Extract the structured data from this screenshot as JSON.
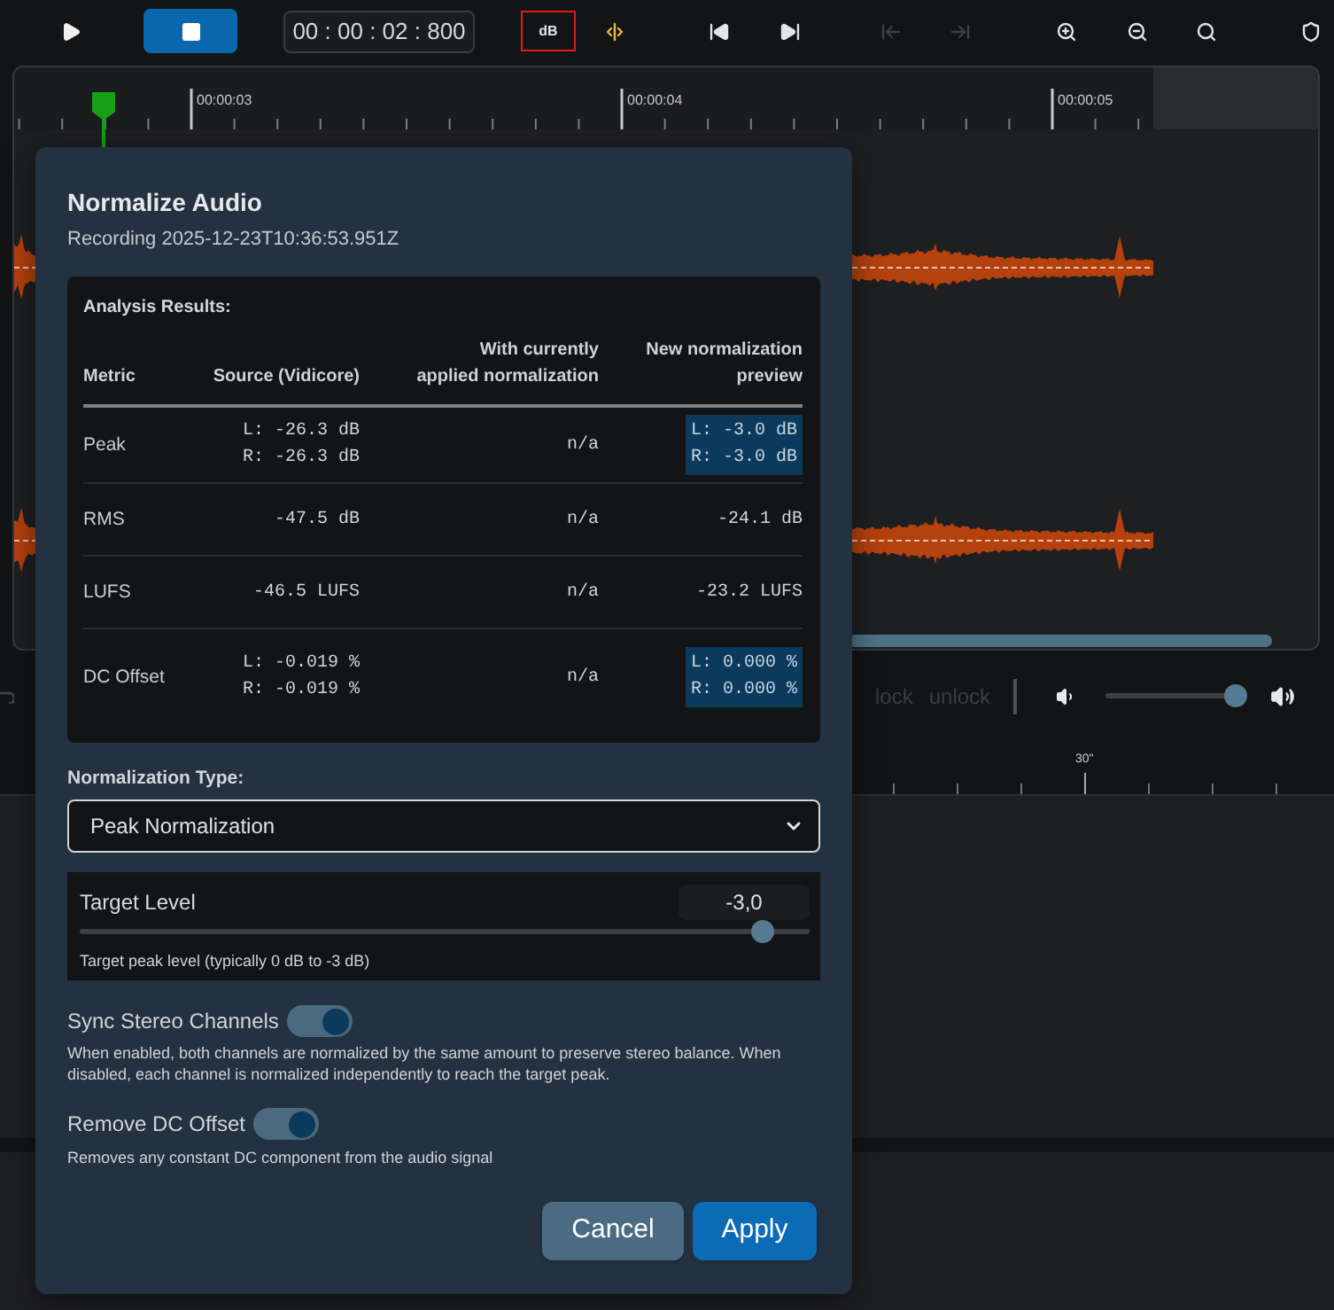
{
  "toolbar": {
    "transport": [
      {
        "kind": "play",
        "active": false
      },
      {
        "kind": "stop",
        "active": true
      }
    ],
    "time_display": "00 : 00 : 02 : 800",
    "tools": [
      {
        "kind": "text",
        "label": "dB",
        "highlighted": true,
        "disabled": false
      },
      {
        "kind": "split",
        "highlighted": false,
        "disabled": false
      },
      {
        "kind": "skip-start",
        "highlighted": false,
        "disabled": false
      },
      {
        "kind": "skip-end",
        "highlighted": false,
        "disabled": false
      },
      {
        "kind": "step-back",
        "highlighted": false,
        "disabled": true
      },
      {
        "kind": "step-forward",
        "highlighted": false,
        "disabled": true
      },
      {
        "kind": "zoom-in",
        "highlighted": false,
        "disabled": false
      },
      {
        "kind": "zoom-out",
        "highlighted": false,
        "disabled": false
      },
      {
        "kind": "zoom-fit",
        "highlighted": false,
        "disabled": false
      },
      {
        "kind": "marker",
        "highlighted": false,
        "disabled": false
      }
    ]
  },
  "timeline": {
    "ruler_labels": [
      "00:00:03",
      "00:00:04",
      "00:00:05"
    ]
  },
  "track_controls": {
    "buttons": [
      {
        "label": "lock",
        "disabled": true
      },
      {
        "label": "unlock",
        "disabled": true
      }
    ],
    "volume": {
      "level": 1
    }
  },
  "bottom_ruler": {
    "labels": [
      "30\""
    ]
  },
  "dialog": {
    "title": "Normalize Audio",
    "subtitle": "Recording 2025-12-23T10:36:53.951Z",
    "analysis": {
      "heading": "Analysis Results:",
      "columns": [
        "Metric",
        "Source (Vidicore)",
        "With currently applied normalization",
        "New normalization preview"
      ],
      "rows": [
        {
          "metric": "Peak",
          "source": [
            "L: -26.3 dB",
            "R: -26.3 dB"
          ],
          "current": [
            "n/a"
          ],
          "preview": [
            "L: -3.0 dB",
            "R: -3.0 dB"
          ],
          "preview_highlighted": true
        },
        {
          "metric": "RMS",
          "source": [
            "-47.5 dB"
          ],
          "current": [
            "n/a"
          ],
          "preview": [
            "-24.1 dB"
          ],
          "preview_highlighted": false
        },
        {
          "metric": "LUFS",
          "source": [
            "-46.5 LUFS"
          ],
          "current": [
            "n/a"
          ],
          "preview": [
            "-23.2 LUFS"
          ],
          "preview_highlighted": false
        },
        {
          "metric": "DC Offset",
          "source": [
            "L: -0.019 %",
            "R: -0.019 %"
          ],
          "current": [
            "n/a"
          ],
          "preview": [
            "L: 0.000 %",
            "R: 0.000 %"
          ],
          "preview_highlighted": true
        }
      ]
    },
    "normalization_type": {
      "label": "Normalization Type:",
      "value": "Peak Normalization"
    },
    "target_level": {
      "label": "Target Level",
      "value": "-3,0",
      "level": 0.95,
      "hint": "Target peak level (typically 0 dB to -3 dB)"
    },
    "options": [
      {
        "label": "Sync Stereo Channels",
        "on": true,
        "description": "When enabled, both channels are normalized by the same amount to preserve stereo balance. When disabled, each channel is normalized independently to reach the target peak."
      },
      {
        "label": "Remove DC Offset",
        "on": true,
        "description": "Removes any constant DC component from the audio signal"
      }
    ],
    "buttons": [
      {
        "label": "Cancel",
        "kind": "secondary"
      },
      {
        "label": "Apply",
        "kind": "primary"
      }
    ]
  }
}
